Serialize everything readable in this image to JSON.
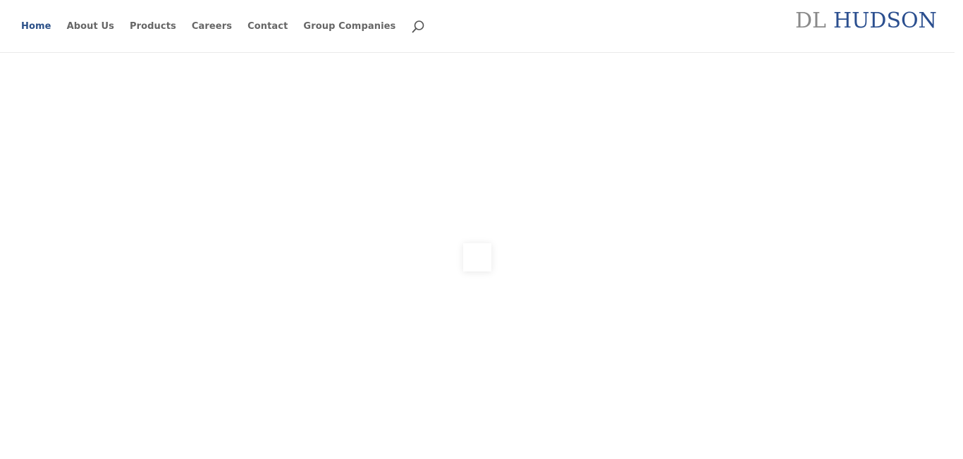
{
  "nav": {
    "items": [
      {
        "label": "Home",
        "active": true
      },
      {
        "label": "About Us",
        "active": false
      },
      {
        "label": "Products",
        "active": false
      },
      {
        "label": "Careers",
        "active": false
      },
      {
        "label": "Contact",
        "active": false
      },
      {
        "label": "Group Companies",
        "active": false
      }
    ],
    "search_icon": "search-icon"
  },
  "logo": {
    "part1": "DL",
    "part2": "HUDSON"
  },
  "colors": {
    "nav_active": "#2b5088",
    "nav_text": "#666666",
    "logo_grey": "#8a8a8a",
    "logo_blue": "#2b4f8f",
    "header_border": "#e9e9e9"
  }
}
